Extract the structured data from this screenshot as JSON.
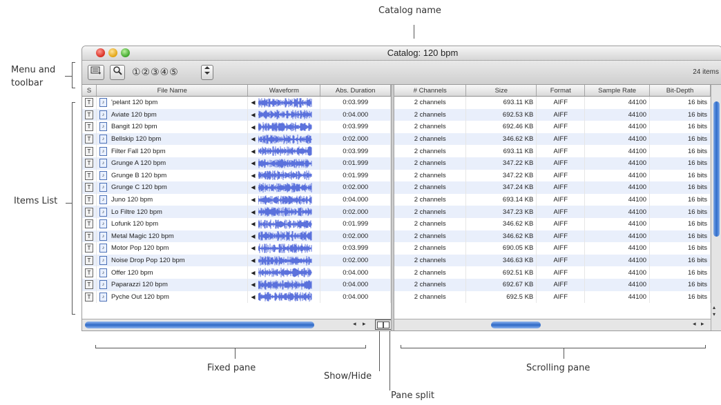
{
  "callouts": {
    "catalog_name": "Catalog name",
    "menu_toolbar_1": "Menu and",
    "menu_toolbar_2": "toolbar",
    "items_list": "Items List",
    "fixed_pane": "Fixed pane",
    "show_hide": "Show/Hide",
    "pane_split": "Pane split",
    "scrolling_pane": "Scrolling pane"
  },
  "window": {
    "title": "Catalog: 120 bpm",
    "items_count": "24 items",
    "toolbar": {
      "search_icon": "magnifier-icon",
      "numbers": "①②③④⑤",
      "sort_icon": "sort-arrows-icon"
    }
  },
  "fixed_columns": [
    "S",
    "File Name",
    "Waveform",
    "Abs. Duration"
  ],
  "scroll_columns": [
    "# Channels",
    "Size",
    "Format",
    "Sample Rate",
    "Bit-Depth"
  ],
  "rows": [
    {
      "s": "T",
      "name": "'pelant 120 bpm",
      "duration": "0:03.999",
      "channels": "2 channels",
      "size": "693.11 KB",
      "format": "AIFF",
      "rate": "44100",
      "depth": "16 bits"
    },
    {
      "s": "T",
      "name": "Aviate 120 bpm",
      "duration": "0:04.000",
      "channels": "2 channels",
      "size": "692.53 KB",
      "format": "AIFF",
      "rate": "44100",
      "depth": "16 bits"
    },
    {
      "s": "T",
      "name": "Bangit 120 bpm",
      "duration": "0:03.999",
      "channels": "2 channels",
      "size": "692.46 KB",
      "format": "AIFF",
      "rate": "44100",
      "depth": "16 bits"
    },
    {
      "s": "T",
      "name": "Bellskip 120 bpm",
      "duration": "0:02.000",
      "channels": "2 channels",
      "size": "346.62 KB",
      "format": "AIFF",
      "rate": "44100",
      "depth": "16 bits"
    },
    {
      "s": "T",
      "name": "Filter Fall 120 bpm",
      "duration": "0:03.999",
      "channels": "2 channels",
      "size": "693.11 KB",
      "format": "AIFF",
      "rate": "44100",
      "depth": "16 bits"
    },
    {
      "s": "T",
      "name": "Grunge A 120 bpm",
      "duration": "0:01.999",
      "channels": "2 channels",
      "size": "347.22 KB",
      "format": "AIFF",
      "rate": "44100",
      "depth": "16 bits"
    },
    {
      "s": "T",
      "name": "Grunge B 120 bpm",
      "duration": "0:01.999",
      "channels": "2 channels",
      "size": "347.22 KB",
      "format": "AIFF",
      "rate": "44100",
      "depth": "16 bits"
    },
    {
      "s": "T",
      "name": "Grunge C 120 bpm",
      "duration": "0:02.000",
      "channels": "2 channels",
      "size": "347.24 KB",
      "format": "AIFF",
      "rate": "44100",
      "depth": "16 bits"
    },
    {
      "s": "T",
      "name": "Juno 120 bpm",
      "duration": "0:04.000",
      "channels": "2 channels",
      "size": "693.14 KB",
      "format": "AIFF",
      "rate": "44100",
      "depth": "16 bits"
    },
    {
      "s": "T",
      "name": "Lo Filtre 120 bpm",
      "duration": "0:02.000",
      "channels": "2 channels",
      "size": "347.23 KB",
      "format": "AIFF",
      "rate": "44100",
      "depth": "16 bits"
    },
    {
      "s": "T",
      "name": "Lofunk 120 bpm",
      "duration": "0:01.999",
      "channels": "2 channels",
      "size": "346.62 KB",
      "format": "AIFF",
      "rate": "44100",
      "depth": "16 bits"
    },
    {
      "s": "T",
      "name": "Metal Magic 120 bpm",
      "duration": "0:02.000",
      "channels": "2 channels",
      "size": "346.62 KB",
      "format": "AIFF",
      "rate": "44100",
      "depth": "16 bits"
    },
    {
      "s": "T",
      "name": "Motor Pop 120 bpm",
      "duration": "0:03.999",
      "channels": "2 channels",
      "size": "690.05 KB",
      "format": "AIFF",
      "rate": "44100",
      "depth": "16 bits"
    },
    {
      "s": "T",
      "name": "Noise Drop Pop 120 bpm",
      "duration": "0:02.000",
      "channels": "2 channels",
      "size": "346.63 KB",
      "format": "AIFF",
      "rate": "44100",
      "depth": "16 bits"
    },
    {
      "s": "T",
      "name": "Offer 120 bpm",
      "duration": "0:04.000",
      "channels": "2 channels",
      "size": "692.51 KB",
      "format": "AIFF",
      "rate": "44100",
      "depth": "16 bits"
    },
    {
      "s": "T",
      "name": "Paparazzi 120 bpm",
      "duration": "0:04.000",
      "channels": "2 channels",
      "size": "692.67 KB",
      "format": "AIFF",
      "rate": "44100",
      "depth": "16 bits"
    },
    {
      "s": "T",
      "name": "Pyche Out 120 bpm",
      "duration": "0:04.000",
      "channels": "2 channels",
      "size": "692.5 KB",
      "format": "AIFF",
      "rate": "44100",
      "depth": "16 bits"
    }
  ],
  "colors": {
    "waveform": "#4a63d8",
    "row_alt": "#e9effb",
    "scroll_thumb": "#2f6cc9"
  }
}
